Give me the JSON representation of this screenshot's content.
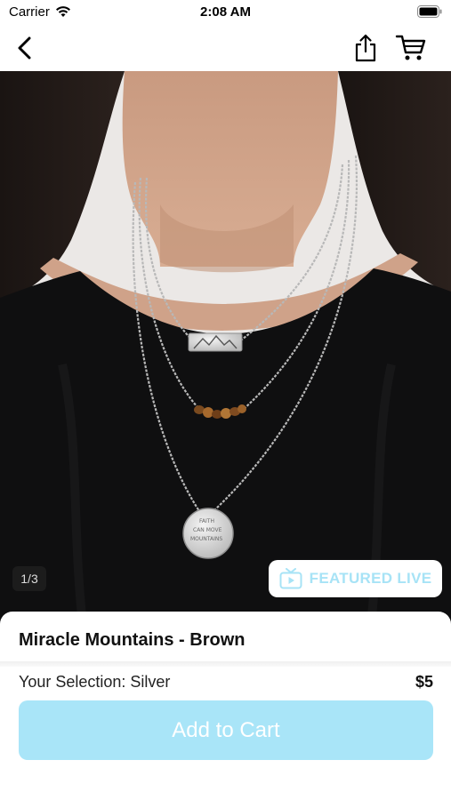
{
  "status_bar": {
    "carrier": "Carrier",
    "time": "2:08 AM"
  },
  "nav": {
    "back_icon": "chevron-left-icon",
    "share_icon": "share-icon",
    "cart_icon": "cart-icon"
  },
  "gallery": {
    "page_indicator": "1/3",
    "featured_live_label": "FEATURED LIVE",
    "featured_live_icon": "tv-play-icon"
  },
  "product": {
    "name": "Miracle Mountains - Brown",
    "selection_text": "Your Selection: Silver",
    "price": "$5",
    "pendant_text_1": "FAITH",
    "pendant_text_2": "CAN MOVE",
    "pendant_text_3": "MOUNTAINS"
  },
  "actions": {
    "add_to_cart_label": "Add to Cart"
  },
  "colors": {
    "accent": "#a9e5f8",
    "featured_text": "#a7e3f6"
  }
}
